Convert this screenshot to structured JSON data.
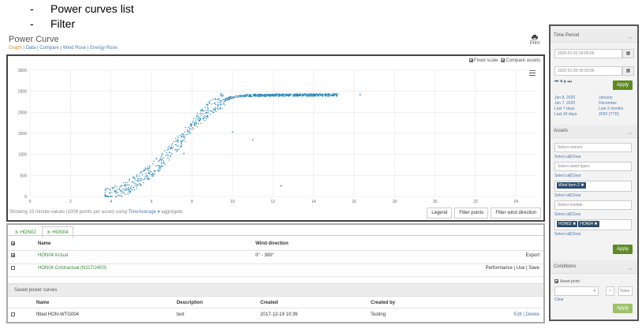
{
  "bullets": [
    {
      "dash": "-",
      "text": "Power curves list"
    },
    {
      "dash": "-",
      "text": "Filter"
    }
  ],
  "page": {
    "title": "Power Curve",
    "tabs": [
      "Graph",
      "Data",
      "Compare",
      "Wind Rose",
      "Energy Rose"
    ],
    "tab_sep": "|",
    "print_label": "Print"
  },
  "chart_controls": {
    "fixed_scale": "Fixed scale",
    "compare_assets": "Compare assets"
  },
  "chart_data": {
    "type": "scatter",
    "title": "",
    "xlabel": "",
    "ylabel": "",
    "xlim": [
      0,
      25
    ],
    "ylim": [
      0,
      3000
    ],
    "x_ticks": [
      0,
      2,
      4,
      6,
      8,
      10,
      12,
      14,
      16,
      18,
      20,
      22,
      24
    ],
    "y_ticks": [
      0,
      500,
      1000,
      1500,
      2000,
      2500,
      3000
    ],
    "grid": true,
    "color": "#2e8ab8",
    "outliers": [
      {
        "x": 12.4,
        "y": 250
      },
      {
        "x": 11.0,
        "y": 1350
      },
      {
        "x": 10.0,
        "y": 1530
      },
      {
        "x": 16.3,
        "y": 2420
      },
      {
        "x": 7.6,
        "y": 1020
      }
    ],
    "fit_curve": [
      [
        3.6,
        0
      ],
      [
        4.0,
        60
      ],
      [
        4.5,
        150
      ],
      [
        5.0,
        280
      ],
      [
        5.5,
        430
      ],
      [
        6.0,
        620
      ],
      [
        6.5,
        840
      ],
      [
        7.0,
        1100
      ],
      [
        7.5,
        1380
      ],
      [
        8.0,
        1670
      ],
      [
        8.5,
        1930
      ],
      [
        9.0,
        2140
      ],
      [
        9.5,
        2280
      ],
      [
        10.0,
        2360
      ],
      [
        10.5,
        2390
      ],
      [
        11.0,
        2400
      ],
      [
        12.0,
        2405
      ],
      [
        13.0,
        2410
      ],
      [
        14.0,
        2410
      ],
      [
        15.0,
        2410
      ]
    ]
  },
  "chart_footer": {
    "prefix": "Showing 10 minute values (1008 points per asset) using",
    "agg": "TimeAverage",
    "caret": "▾",
    "suffix": "aggregate."
  },
  "chart_buttons": [
    "Legend",
    "Filter points",
    "Filter wind direction"
  ],
  "asset_tabs": [
    {
      "label": "HON02",
      "active": false
    },
    {
      "label": "HON04",
      "active": true
    }
  ],
  "curves_table": {
    "headers": [
      "Name",
      "Wind direction"
    ],
    "rows": [
      {
        "checked": true,
        "name": "HON04 Actual",
        "wind": "0° - 360°",
        "actions": "Export"
      },
      {
        "checked": false,
        "name": "HON04 Contractual (N117/2400)",
        "wind": "",
        "actions": "Performance | Use | Save"
      }
    ]
  },
  "saved": {
    "title": "Saved power curves",
    "headers": [
      "Name",
      "Description",
      "Created",
      "Created by"
    ],
    "rows": [
      {
        "name": "fitted HON-WTG004",
        "description": "test",
        "created": "2017-12-19 10:39",
        "created_by": "Testing",
        "actions": "Edit | Delete"
      }
    ]
  },
  "sidebar": {
    "time_period": {
      "title": "Time Period",
      "from": "2020-01-02 00:00:00",
      "to": "2020-01-09 00:00:00",
      "apply": "Apply",
      "quick_left": [
        "Jan 8, 2020",
        "Jan 7, 2020",
        "Last 7 days",
        "Last 30 days"
      ],
      "quick_right": [
        "January",
        "December",
        "Last 3 months",
        "2020 (YTD)"
      ]
    },
    "assets": {
      "title": "Assets",
      "owners_ph": "Select owners",
      "types_ph": "Select asset types",
      "models_ph": "Select models",
      "select_all": "Select all",
      "clear": "Clear",
      "farm_tag": "Wind farm 2",
      "asset_tags": [
        "HON02",
        "HON04"
      ],
      "apply": "Apply"
    },
    "conditions": {
      "title": "Conditions",
      "asset_point": "Asset point",
      "op": ">",
      "value_ph": "Value",
      "clear": "Clear",
      "apply": "Apply"
    }
  }
}
